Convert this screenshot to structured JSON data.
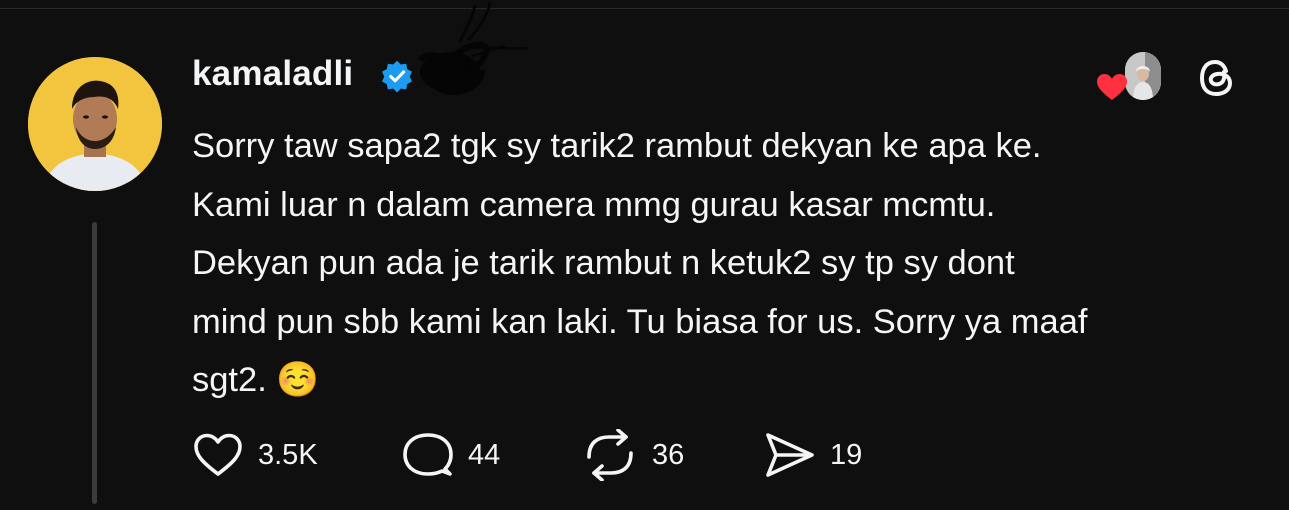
{
  "post": {
    "username": "kamaladli",
    "text": "Sorry taw sapa2 tgk sy tarik2 rambut dekyan ke apa ke.\nKami luar n dalam camera mmg gurau kasar mcmtu.\nDekyan pun ada je tarik rambut n ketuk2 sy tp sy dont\nmind pun sbb kami kan laki. Tu biasa for us. Sorry ya maaf\nsgt2. ☺️"
  },
  "actions": {
    "likes": "3.5K",
    "replies": "44",
    "reposts": "36",
    "shares": "19"
  },
  "icons": {
    "verified": "verified-badge-icon",
    "like": "heart-icon",
    "reply": "comment-bubble-icon",
    "repost": "repost-icon",
    "share": "send-icon",
    "app": "threads-logo-icon"
  },
  "colors": {
    "background": "#0f0f0f",
    "text": "#f3f5f7",
    "verified": "#1d9bf0",
    "heart": "#ff3040"
  }
}
